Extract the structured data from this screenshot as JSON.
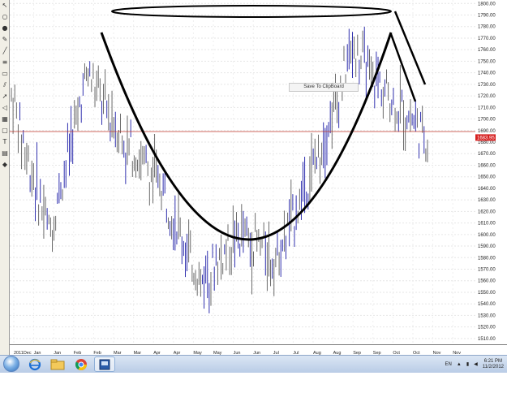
{
  "context_menu": {
    "label": "Save To ClipBoard"
  },
  "price_label": {
    "value": "1683.95",
    "color": "#d62020"
  },
  "y_axis": {
    "ticks": [
      "1800.00",
      "1790.00",
      "1780.00",
      "1770.00",
      "1760.00",
      "1750.00",
      "1740.00",
      "1730.00",
      "1720.00",
      "1710.00",
      "1700.00",
      "1690.00",
      "1680.00",
      "1670.00",
      "1660.00",
      "1650.00",
      "1640.00",
      "1630.00",
      "1620.00",
      "1610.00",
      "1600.00",
      "1590.00",
      "1580.00",
      "1570.00",
      "1560.00",
      "1550.00",
      "1540.00",
      "1530.00",
      "1520.00",
      "1510.00"
    ]
  },
  "x_axis": {
    "labels": [
      "2011Dec",
      "Jan",
      "Jan",
      "Feb",
      "Feb",
      "Mar",
      "Mar",
      "Apr",
      "Apr",
      "May",
      "May",
      "Jun",
      "Jun",
      "Jul",
      "Jul",
      "Aug",
      "Aug",
      "Sep",
      "Sep",
      "Oct",
      "Oct",
      "Nov",
      "Nov"
    ]
  },
  "taskbar": {
    "icons": [
      "ie-icon",
      "folder-icon",
      "chrome-icon",
      "trading-app-icon"
    ],
    "language": "EN",
    "time": "6:21 PM",
    "date": "11/2/2012"
  },
  "chart_data": {
    "type": "bar",
    "title": "",
    "xlabel": "",
    "ylabel": "",
    "ylim": [
      1505,
      1803
    ],
    "grid": true,
    "current_price": 1683.95,
    "x": [
      "2011Dec",
      "Jan",
      "Feb",
      "Mar",
      "Apr",
      "May",
      "Jun",
      "Jul",
      "Aug",
      "Sep",
      "Oct",
      "Nov"
    ],
    "close_approx": [
      1720,
      1600,
      1740,
      1680,
      1640,
      1560,
      1600,
      1580,
      1660,
      1760,
      1720,
      1683.95
    ],
    "annotations": [
      {
        "type": "ellipse",
        "label": ""
      },
      {
        "type": "cup-curve",
        "label": ""
      },
      {
        "type": "handle-lines",
        "label": ""
      }
    ]
  }
}
